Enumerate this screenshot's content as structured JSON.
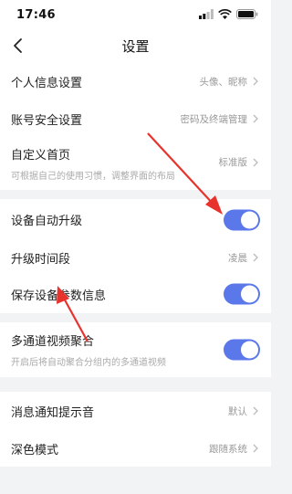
{
  "status_bar": {
    "time": "17:46"
  },
  "header": {
    "title": "设置"
  },
  "groups": [
    {
      "items": [
        {
          "label": "个人信息设置",
          "value": "头像、昵称"
        },
        {
          "label": "账号安全设置",
          "value": "密码及终端管理"
        },
        {
          "label": "自定义首页",
          "value": "标准版",
          "subtitle": "可根据自己的使用习惯，调整界面的布局"
        }
      ]
    },
    {
      "items": [
        {
          "label": "设备自动升级",
          "toggle": true
        },
        {
          "label": "升级时间段",
          "value": "凌晨"
        },
        {
          "label": "保存设备参数信息",
          "toggle": true
        }
      ]
    },
    {
      "items": [
        {
          "label": "多通道视频聚合",
          "toggle": true,
          "subtitle": "开启后将自动聚合分组内的多通道视频"
        }
      ]
    },
    {
      "items": [
        {
          "label": "消息通知提示音",
          "value": "默认"
        },
        {
          "label": "深色模式",
          "value": "跟随系统"
        }
      ]
    }
  ],
  "colors": {
    "accent": "#5b78ea",
    "annotation_arrow": "#e8332d",
    "background": "#f2f3f5"
  }
}
